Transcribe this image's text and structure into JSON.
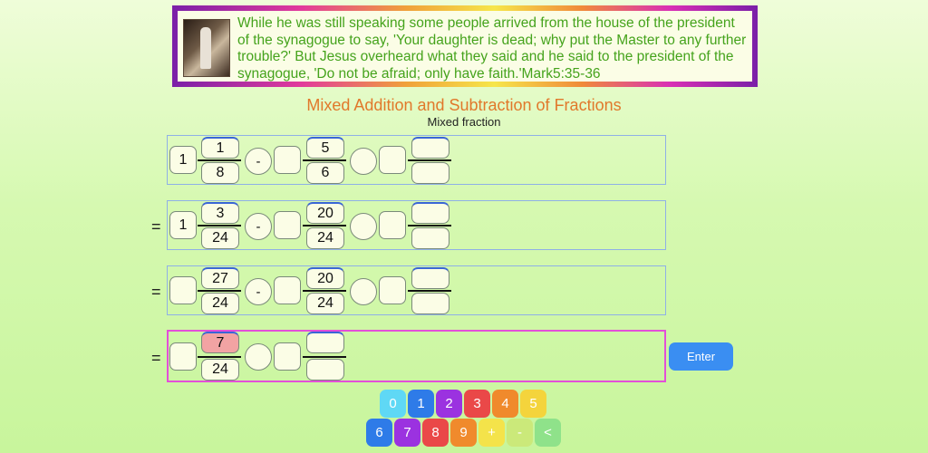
{
  "quote": {
    "text": "While he was still speaking some people arrived from the house of the president of the synagogue to say, 'Your daughter is dead; why put the Master to any further trouble?' But Jesus overheard what they said and he said to the president of the synagogue, 'Do not be afraid; only have faith.'Mark5:35-36"
  },
  "header": {
    "title": "Mixed Addition and Subtraction of Fractions",
    "subtitle": "Mixed fraction"
  },
  "rows": [
    {
      "eq": "",
      "whole1": "1",
      "num1": "1",
      "den1": "8",
      "op1": "-",
      "whole2": "",
      "num2": "5",
      "den2": "6",
      "op2": "",
      "whole3": "",
      "num3": "",
      "den3": ""
    },
    {
      "eq": "=",
      "whole1": "1",
      "num1": "3",
      "den1": "24",
      "op1": "-",
      "whole2": "",
      "num2": "20",
      "den2": "24",
      "op2": "",
      "whole3": "",
      "num3": "",
      "den3": ""
    },
    {
      "eq": "=",
      "whole1": "",
      "num1": "27",
      "den1": "24",
      "op1": "-",
      "whole2": "",
      "num2": "20",
      "den2": "24",
      "op2": "",
      "whole3": "",
      "num3": "",
      "den3": ""
    },
    {
      "eq": "=",
      "whole1": "",
      "num1": "7",
      "den1": "24",
      "op1": "",
      "whole2": "",
      "num2": "",
      "den2": ""
    }
  ],
  "enter_label": "Enter",
  "keypad": {
    "row1": [
      {
        "label": "0",
        "color": "#5fd8f5"
      },
      {
        "label": "1",
        "color": "#2e7be8"
      },
      {
        "label": "2",
        "color": "#9b32e0"
      },
      {
        "label": "3",
        "color": "#ea4848"
      },
      {
        "label": "4",
        "color": "#f08a2c"
      },
      {
        "label": "5",
        "color": "#f4d43c"
      }
    ],
    "row2": [
      {
        "label": "6",
        "color": "#2e7be8"
      },
      {
        "label": "7",
        "color": "#9b32e0"
      },
      {
        "label": "8",
        "color": "#ea4848"
      },
      {
        "label": "9",
        "color": "#f08a2c"
      },
      {
        "label": "+",
        "color": "#f4e34a"
      },
      {
        "label": "-",
        "color": "#cbe97a"
      },
      {
        "label": "<",
        "color": "#8fe28a"
      }
    ]
  }
}
